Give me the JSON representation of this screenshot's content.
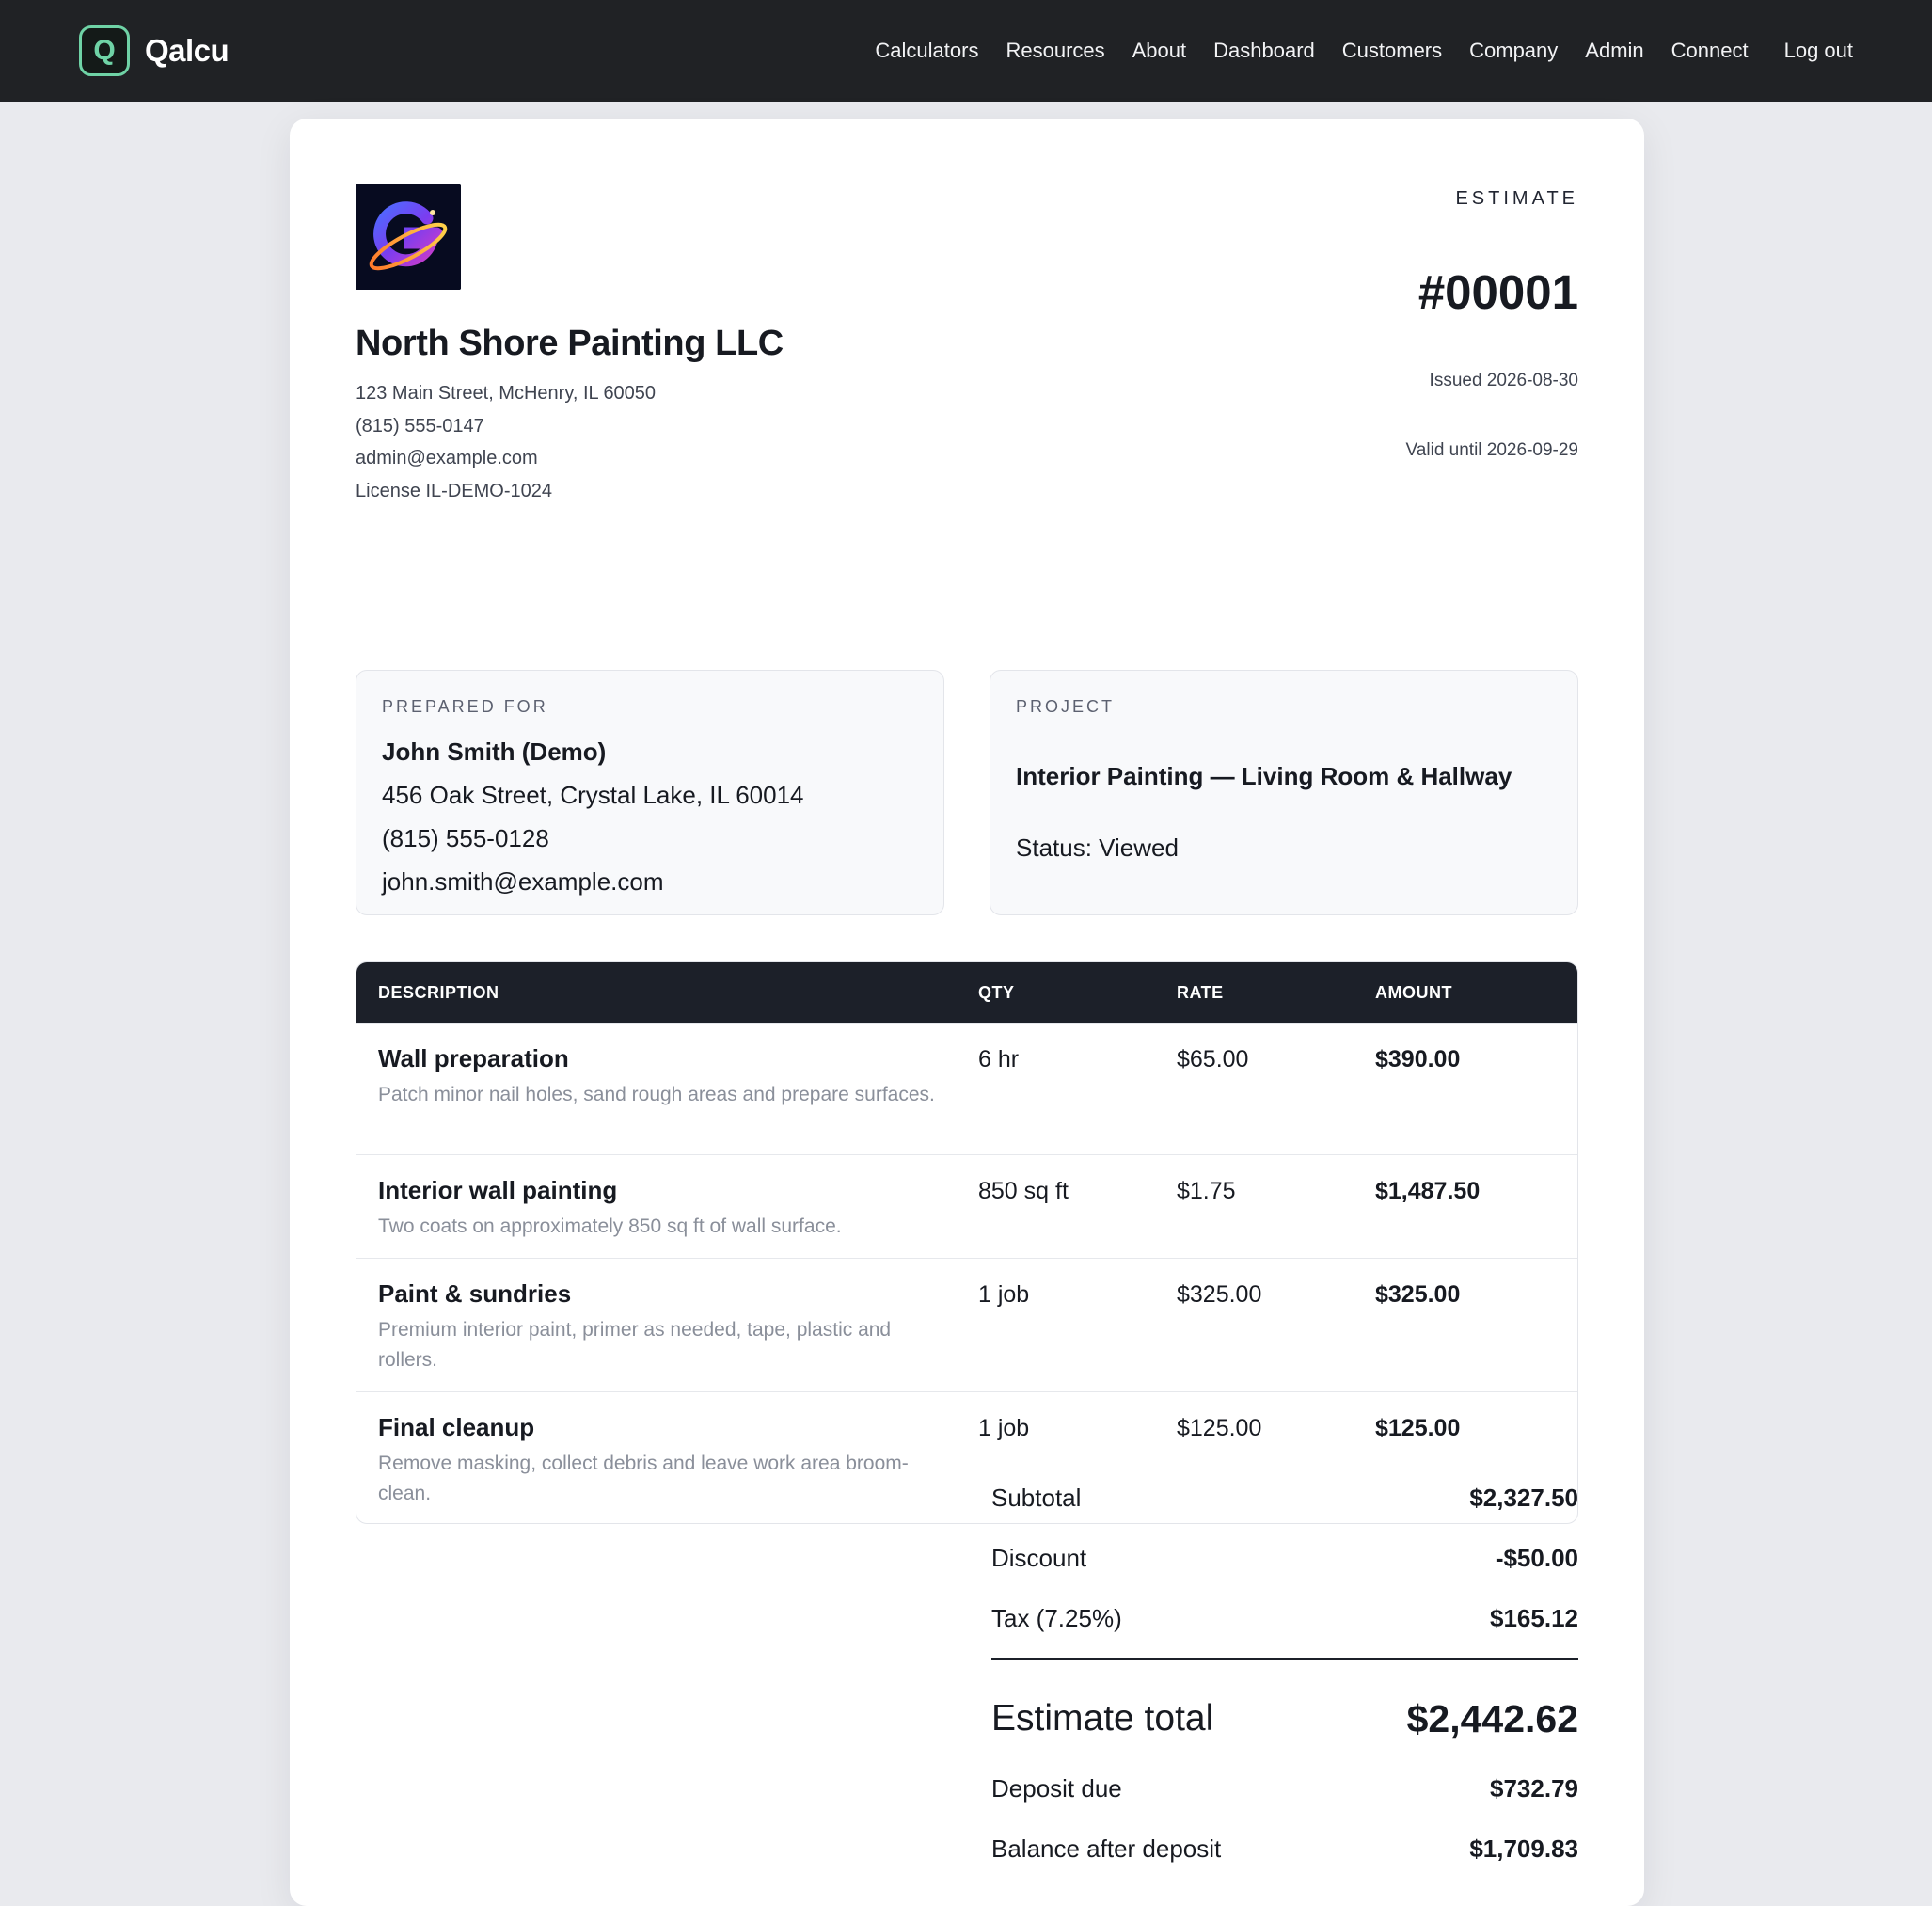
{
  "nav": {
    "brand_mark": "Q",
    "brand_name": "Qalcu",
    "items": [
      "Calculators",
      "Resources",
      "About",
      "Dashboard",
      "Customers",
      "Company",
      "Admin",
      "Connect"
    ],
    "logout": "Log out"
  },
  "company": {
    "name": "North Shore Painting LLC",
    "address": "123 Main Street, McHenry, IL 60050",
    "phone": "(815) 555-0147",
    "email": "admin@example.com",
    "license": "License IL-DEMO-1024"
  },
  "estimate": {
    "label": "ESTIMATE",
    "number": "#00001",
    "issued": "Issued 2026-08-30",
    "valid_until": "Valid until 2026-09-29"
  },
  "prepared_for": {
    "label": "PREPARED FOR",
    "name": "John Smith (Demo)",
    "address": "456 Oak Street, Crystal Lake, IL 60014",
    "phone": "(815) 555-0128",
    "email": "john.smith@example.com"
  },
  "project": {
    "label": "PROJECT",
    "title": "Interior Painting — Living Room & Hallway",
    "status": "Status: Viewed"
  },
  "table": {
    "headers": {
      "description": "DESCRIPTION",
      "qty": "QTY",
      "rate": "RATE",
      "amount": "AMOUNT"
    },
    "rows": [
      {
        "title": "Wall preparation",
        "sub": "Patch minor nail holes, sand rough areas and prepare surfaces.",
        "qty": "6 hr",
        "rate": "$65.00",
        "amount": "$390.00"
      },
      {
        "title": "Interior wall painting",
        "sub": "Two coats on approximately 850 sq ft of wall surface.",
        "qty": "850 sq ft",
        "rate": "$1.75",
        "amount": "$1,487.50"
      },
      {
        "title": "Paint & sundries",
        "sub": "Premium interior paint, primer as needed, tape, plastic and rollers.",
        "qty": "1 job",
        "rate": "$325.00",
        "amount": "$325.00"
      },
      {
        "title": "Final cleanup",
        "sub": "Remove masking, collect debris and leave work area broom-clean.",
        "qty": "1 job",
        "rate": "$125.00",
        "amount": "$125.00"
      }
    ]
  },
  "totals": {
    "subtotal_label": "Subtotal",
    "subtotal": "$2,327.50",
    "discount_label": "Discount",
    "discount": "-$50.00",
    "tax_label": "Tax (7.25%)",
    "tax": "$165.12",
    "total_label": "Estimate total",
    "total": "$2,442.62",
    "deposit_label": "Deposit due",
    "deposit": "$732.79",
    "balance_label": "Balance after deposit",
    "balance": "$1,709.83"
  },
  "colors": {
    "nav_bg": "#202225",
    "brand_accent": "#6fd3a6",
    "table_header_bg": "#1c2029"
  }
}
